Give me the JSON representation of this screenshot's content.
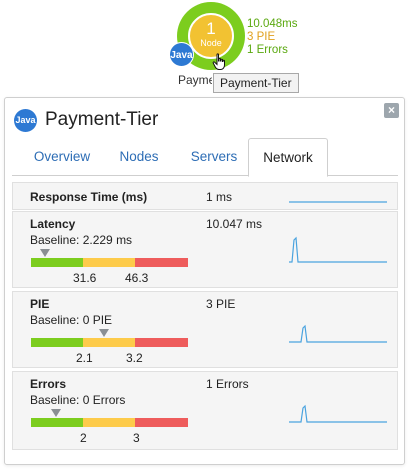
{
  "node": {
    "count": "1",
    "word": "Node",
    "badge": "Java",
    "name": "Payment-Tier",
    "stats": [
      "10.048ms",
      "3 PIE",
      "1 Errors"
    ],
    "tooltip": "Payment-Tier"
  },
  "panel": {
    "badge": "Java",
    "title": "Payment-Tier",
    "close": "×",
    "tabs": [
      "Overview",
      "Nodes",
      "Servers",
      "Network"
    ],
    "active_tab": "Network"
  },
  "metrics": {
    "response": {
      "name": "Response Time (ms)",
      "value": "1 ms"
    },
    "latency": {
      "name": "Latency",
      "baseline": "Baseline: 2.229 ms",
      "value": "10.047 ms",
      "t1": "31.6",
      "t2": "46.3"
    },
    "pie": {
      "name": "PIE",
      "baseline": "Baseline: 0 PIE",
      "value": "3 PIE",
      "t1": "2.1",
      "t2": "3.2"
    },
    "errors": {
      "name": "Errors",
      "baseline": "Baseline: 0 Errors",
      "value": "1 Errors",
      "t1": "2",
      "t2": "3"
    }
  },
  "colors": {
    "green": "#7ccd1e",
    "yellow": "#fdcb4a",
    "red": "#ee5c5c",
    "link": "#2d6db5",
    "spark": "#4aa3df"
  },
  "icons": [
    "java-icon",
    "hand-cursor-icon",
    "close-icon"
  ]
}
